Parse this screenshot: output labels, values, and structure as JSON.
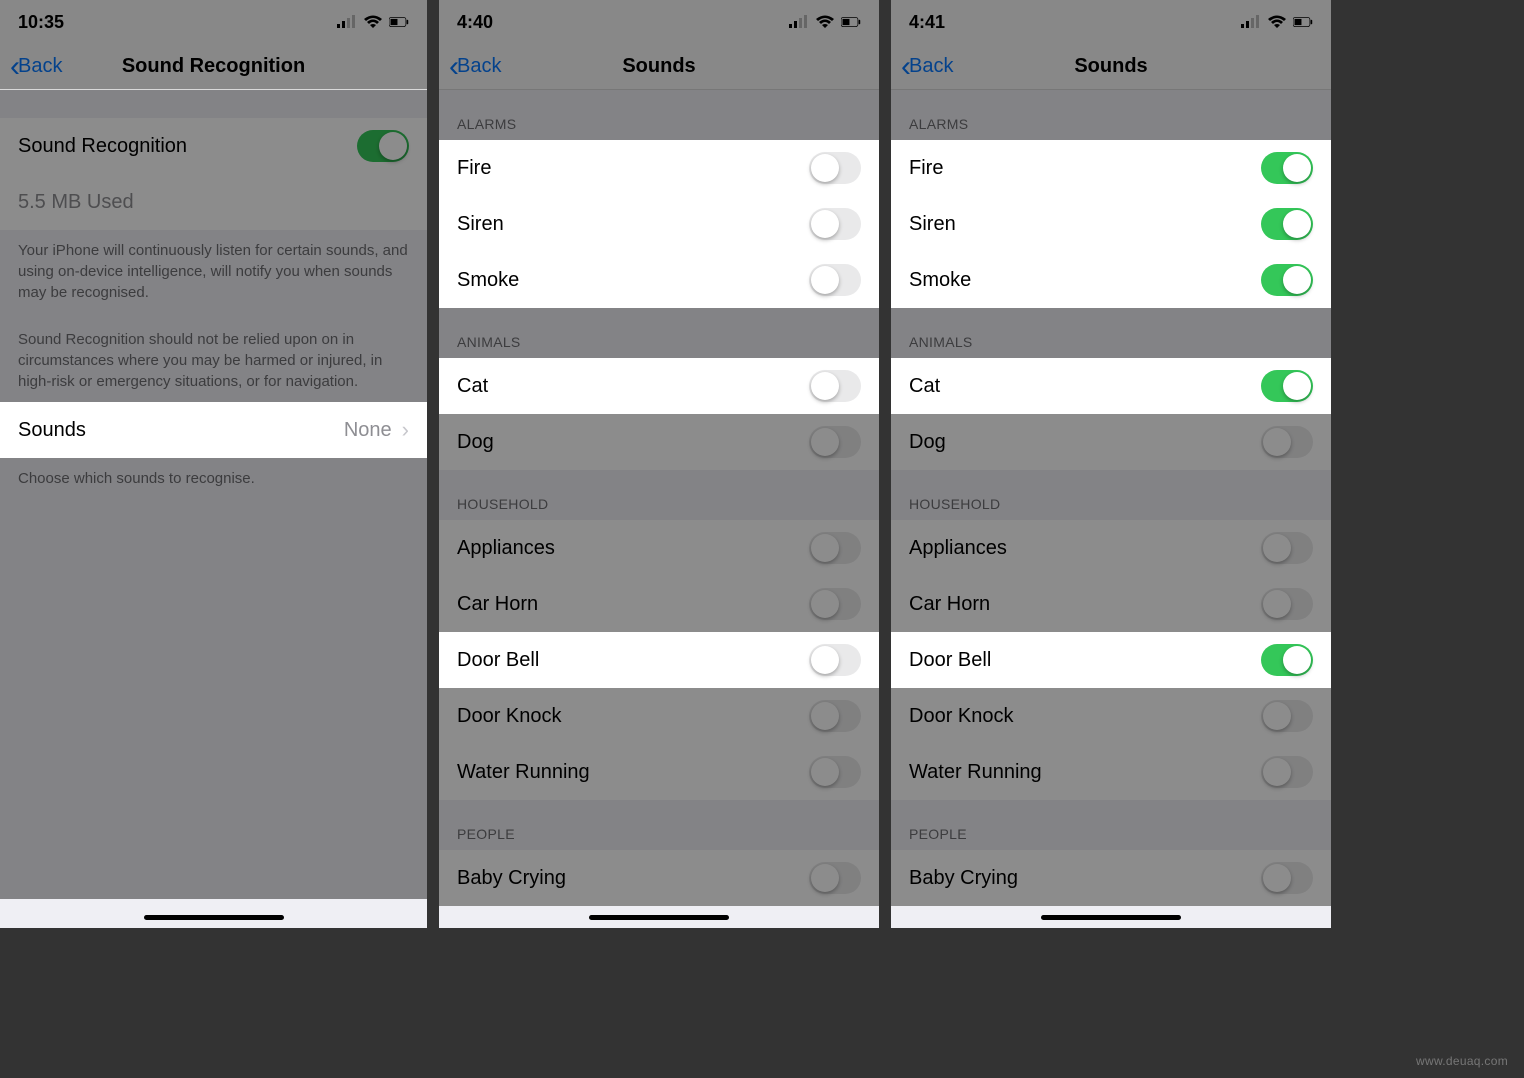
{
  "watermark": "www.deuaq.com",
  "panels": [
    {
      "time": "10:35",
      "back": "Back",
      "title": "Sound Recognition",
      "main_toggle_label": "Sound Recognition",
      "main_toggle_on": true,
      "storage": "5.5 MB Used",
      "desc1": "Your iPhone will continuously listen for certain sounds, and using on-device intelligence, will notify you when sounds may be recognised.",
      "desc2": "Sound Recognition should not be relied upon on in circumstances where you may be harmed or injured, in high-risk or emergency situations, or for navigation.",
      "sounds_row_label": "Sounds",
      "sounds_row_value": "None",
      "choose_footer": "Choose which sounds to recognise."
    },
    {
      "time": "4:40",
      "back": "Back",
      "title": "Sounds",
      "sections": [
        {
          "header": "ALARMS",
          "items": [
            {
              "label": "Fire",
              "on": false,
              "highlight": true
            },
            {
              "label": "Siren",
              "on": false,
              "highlight": true
            },
            {
              "label": "Smoke",
              "on": false,
              "highlight": true
            }
          ]
        },
        {
          "header": "ANIMALS",
          "items": [
            {
              "label": "Cat",
              "on": false,
              "highlight": true
            },
            {
              "label": "Dog",
              "on": false,
              "highlight": false
            }
          ]
        },
        {
          "header": "HOUSEHOLD",
          "items": [
            {
              "label": "Appliances",
              "on": false,
              "highlight": false
            },
            {
              "label": "Car Horn",
              "on": false,
              "highlight": false
            },
            {
              "label": "Door Bell",
              "on": false,
              "highlight": true
            },
            {
              "label": "Door Knock",
              "on": false,
              "highlight": false
            },
            {
              "label": "Water Running",
              "on": false,
              "highlight": false
            }
          ]
        },
        {
          "header": "PEOPLE",
          "items": [
            {
              "label": "Baby Crying",
              "on": false,
              "highlight": false
            }
          ]
        }
      ]
    },
    {
      "time": "4:41",
      "back": "Back",
      "title": "Sounds",
      "sections": [
        {
          "header": "ALARMS",
          "items": [
            {
              "label": "Fire",
              "on": true,
              "highlight": true
            },
            {
              "label": "Siren",
              "on": true,
              "highlight": true
            },
            {
              "label": "Smoke",
              "on": true,
              "highlight": true
            }
          ]
        },
        {
          "header": "ANIMALS",
          "items": [
            {
              "label": "Cat",
              "on": true,
              "highlight": true
            },
            {
              "label": "Dog",
              "on": false,
              "highlight": false
            }
          ]
        },
        {
          "header": "HOUSEHOLD",
          "items": [
            {
              "label": "Appliances",
              "on": false,
              "highlight": false
            },
            {
              "label": "Car Horn",
              "on": false,
              "highlight": false
            },
            {
              "label": "Door Bell",
              "on": true,
              "highlight": true
            },
            {
              "label": "Door Knock",
              "on": false,
              "highlight": false
            },
            {
              "label": "Water Running",
              "on": false,
              "highlight": false
            }
          ]
        },
        {
          "header": "PEOPLE",
          "items": [
            {
              "label": "Baby Crying",
              "on": false,
              "highlight": false
            }
          ]
        }
      ]
    }
  ]
}
